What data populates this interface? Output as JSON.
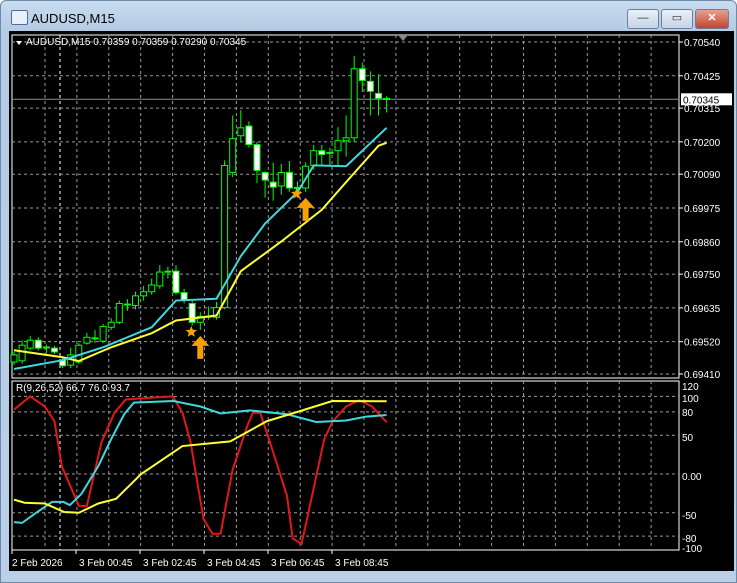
{
  "window": {
    "title": "AUDUSD,M15",
    "minimize": "—",
    "maximize": "▭",
    "close": "✕"
  },
  "chart_data": [
    {
      "type": "candlestick",
      "title": "AUDUSD,M15  0.70359 0.70359 0.70290 0.70345",
      "symbol": "AUDUSD,M15",
      "ohlc_header": "0.70359 0.70359 0.70290 0.70345",
      "current_price": "0.70345",
      "ylim": [
        0.6941,
        0.7054
      ],
      "y_ticks": [
        "0.70540",
        "0.70425",
        "0.70315",
        "0.70200",
        "0.70090",
        "0.69975",
        "0.69860",
        "0.69750",
        "0.69635",
        "0.69520",
        "0.69410"
      ],
      "x_ticks": [
        "2 Feb 2026",
        "3 Feb 00:45",
        "3 Feb 02:45",
        "3 Feb 04:45",
        "3 Feb 06:45",
        "3 Feb 08:45"
      ],
      "grid": true,
      "colors": {
        "candle_outline": "#00ff00",
        "bull_body": "#000000",
        "bear_body": "#ffffff",
        "ma_fast": "#3fd8e0",
        "ma_slow": "#ffff33",
        "signal": "#f5a000"
      },
      "candles": [
        [
          0.69451,
          0.69485,
          0.6944,
          0.69475
        ],
        [
          0.69455,
          0.69525,
          0.69445,
          0.69508
        ],
        [
          0.69498,
          0.6954,
          0.6949,
          0.69525
        ],
        [
          0.69525,
          0.69535,
          0.6949,
          0.69498
        ],
        [
          0.69502,
          0.6951,
          0.6948,
          0.695
        ],
        [
          0.69498,
          0.69505,
          0.69478,
          0.69485
        ],
        [
          0.69458,
          0.6947,
          0.6943,
          0.69438
        ],
        [
          0.6944,
          0.695,
          0.6943,
          0.69475
        ],
        [
          0.69451,
          0.69515,
          0.69445,
          0.69508
        ],
        [
          0.69515,
          0.6955,
          0.6951,
          0.69535
        ],
        [
          0.6953,
          0.6956,
          0.69515,
          0.69533
        ],
        [
          0.69522,
          0.6958,
          0.69515,
          0.69572
        ],
        [
          0.69569,
          0.696,
          0.6956,
          0.69586
        ],
        [
          0.69586,
          0.6966,
          0.6958,
          0.6965
        ],
        [
          0.69645,
          0.69665,
          0.69625,
          0.69648
        ],
        [
          0.69643,
          0.6969,
          0.6963,
          0.69676
        ],
        [
          0.69676,
          0.6971,
          0.6966,
          0.6969
        ],
        [
          0.6969,
          0.69735,
          0.6968,
          0.69713
        ],
        [
          0.6971,
          0.6978,
          0.697,
          0.69757
        ],
        [
          0.69758,
          0.69775,
          0.69735,
          0.6976
        ],
        [
          0.6976,
          0.6978,
          0.6968,
          0.69687
        ],
        [
          0.69687,
          0.697,
          0.6965,
          0.6966
        ],
        [
          0.6965,
          0.6966,
          0.69575,
          0.69586
        ],
        [
          0.69586,
          0.6962,
          0.6956,
          0.69606
        ],
        [
          0.69605,
          0.6964,
          0.69595,
          0.69607
        ],
        [
          0.69603,
          0.69655,
          0.69595,
          0.69636
        ],
        [
          0.69636,
          0.70137,
          0.6963,
          0.7012
        ],
        [
          0.70096,
          0.7029,
          0.7008,
          0.70211
        ],
        [
          0.70221,
          0.70308,
          0.702,
          0.70248
        ],
        [
          0.70254,
          0.7027,
          0.7018,
          0.70191
        ],
        [
          0.70191,
          0.702,
          0.7006,
          0.70103
        ],
        [
          0.70096,
          0.701,
          0.7001,
          0.7007
        ],
        [
          0.70063,
          0.7013,
          0.7,
          0.70046
        ],
        [
          0.7005,
          0.70125,
          0.7002,
          0.70096
        ],
        [
          0.70096,
          0.70135,
          0.7003,
          0.70043
        ],
        [
          0.70045,
          0.70065,
          0.7001,
          0.70043
        ],
        [
          0.70043,
          0.7013,
          0.7003,
          0.70117
        ],
        [
          0.7012,
          0.7019,
          0.70105,
          0.7017
        ],
        [
          0.7017,
          0.7019,
          0.7012,
          0.70157
        ],
        [
          0.70164,
          0.7018,
          0.7012,
          0.70162
        ],
        [
          0.7017,
          0.7025,
          0.7012,
          0.70204
        ],
        [
          0.70204,
          0.7029,
          0.7015,
          0.70214
        ],
        [
          0.70214,
          0.70493,
          0.702,
          0.70449
        ],
        [
          0.70449,
          0.7047,
          0.7037,
          0.70409
        ],
        [
          0.70406,
          0.7044,
          0.7029,
          0.70372
        ],
        [
          0.70365,
          0.7043,
          0.7029,
          0.70348
        ],
        [
          0.70348,
          0.70355,
          0.703,
          0.70345
        ]
      ],
      "ma_fast": [
        [
          0,
          0.69427
        ],
        [
          6,
          0.69457
        ],
        [
          11,
          0.69501
        ],
        [
          17,
          0.69569
        ],
        [
          20,
          0.6966
        ],
        [
          25,
          0.69666
        ],
        [
          28,
          0.69811
        ],
        [
          31,
          0.69922
        ],
        [
          35,
          0.70029
        ],
        [
          37,
          0.7012
        ],
        [
          41,
          0.70117
        ],
        [
          46,
          0.70248
        ]
      ],
      "ma_slow": [
        [
          0,
          0.69491
        ],
        [
          6,
          0.69467
        ],
        [
          8,
          0.69454
        ],
        [
          12,
          0.69501
        ],
        [
          17,
          0.69549
        ],
        [
          20,
          0.69592
        ],
        [
          25,
          0.69609
        ],
        [
          28,
          0.6976
        ],
        [
          33,
          0.69861
        ],
        [
          38,
          0.69969
        ],
        [
          41,
          0.70063
        ],
        [
          45,
          0.70187
        ],
        [
          46,
          0.70197
        ]
      ],
      "buy_signals": [
        23,
        36
      ]
    },
    {
      "type": "line",
      "title": "R(9,26,52) 66.7 76.0 93.7",
      "ylim": [
        -100,
        120
      ],
      "y_ticks": [
        "120",
        "100",
        "80",
        "50",
        "0.00",
        "-50",
        "-80",
        "-100"
      ],
      "grid_levels": [
        100,
        80,
        50,
        0,
        -50,
        -80
      ],
      "series": [
        {
          "color": "#e01818",
          "points": [
            [
              0,
              83
            ],
            [
              2,
              100
            ],
            [
              3.8,
              87
            ],
            [
              5,
              68
            ],
            [
              5.9,
              10
            ],
            [
              7.1,
              -19
            ],
            [
              8,
              -41
            ],
            [
              9,
              -41
            ],
            [
              10.8,
              41
            ],
            [
              12.4,
              79
            ],
            [
              13.8,
              96
            ],
            [
              18,
              99
            ],
            [
              19.6,
              100
            ],
            [
              20.8,
              79
            ],
            [
              21.8,
              41
            ],
            [
              23.4,
              -58
            ],
            [
              24.5,
              -77
            ],
            [
              25.5,
              -77
            ],
            [
              27,
              6
            ],
            [
              28.8,
              62
            ],
            [
              29.5,
              79
            ],
            [
              30.4,
              79
            ],
            [
              32,
              28
            ],
            [
              33.7,
              -28
            ],
            [
              34.4,
              -83
            ],
            [
              35.5,
              -90
            ],
            [
              36.8,
              -28
            ],
            [
              38.3,
              45
            ],
            [
              39.3,
              67
            ],
            [
              41,
              87
            ],
            [
              42.6,
              95
            ],
            [
              44.2,
              87
            ],
            [
              46,
              66.7
            ]
          ]
        },
        {
          "color": "#3fd8e0",
          "points": [
            [
              0,
              -62
            ],
            [
              1,
              -63
            ],
            [
              2.6,
              -51
            ],
            [
              4.7,
              -36
            ],
            [
              6.1,
              -36
            ],
            [
              6.9,
              -40
            ],
            [
              8.3,
              -26
            ],
            [
              10.4,
              10
            ],
            [
              12,
              45
            ],
            [
              13.6,
              77
            ],
            [
              14.8,
              92
            ],
            [
              19.7,
              94
            ],
            [
              23,
              87
            ],
            [
              25.5,
              78
            ],
            [
              29.1,
              82
            ],
            [
              33.7,
              77
            ],
            [
              37.3,
              67
            ],
            [
              41,
              69
            ],
            [
              43.5,
              74
            ],
            [
              46,
              76.0
            ]
          ]
        },
        {
          "color": "#ffff33",
          "points": [
            [
              0,
              -33
            ],
            [
              1.3,
              -37
            ],
            [
              3.8,
              -38
            ],
            [
              6.2,
              -49
            ],
            [
              8,
              -50
            ],
            [
              10.4,
              -38
            ],
            [
              12.6,
              -32
            ],
            [
              15.7,
              0
            ],
            [
              20.8,
              36
            ],
            [
              26.7,
              42
            ],
            [
              31.2,
              68
            ],
            [
              35.3,
              81
            ],
            [
              39.3,
              94
            ],
            [
              46,
              93.7
            ]
          ]
        }
      ]
    }
  ]
}
